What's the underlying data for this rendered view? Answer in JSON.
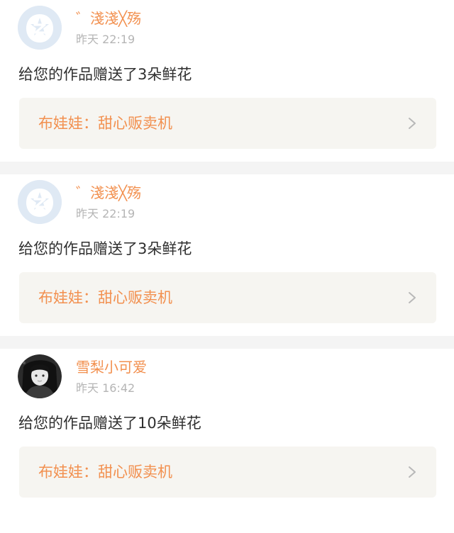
{
  "notifications": [
    {
      "avatar_icon": "qq-default-avatar-icon",
      "username": "゛淺淺╳殇",
      "time": "昨天 22:19",
      "message": "给您的作品赠送了3朵鲜花",
      "work_link": "布娃娃：甜心贩卖机"
    },
    {
      "avatar_icon": "qq-default-avatar-icon",
      "username": "゛淺淺╳殇",
      "time": "昨天 22:19",
      "message": "给您的作品赠送了3朵鲜花",
      "work_link": "布娃娃：甜心贩卖机"
    },
    {
      "avatar_icon": "user-photo-avatar",
      "username": "雪梨小可爱",
      "time": "昨天 16:42",
      "message": "给您的作品赠送了10朵鲜花",
      "work_link": "布娃娃：甜心贩卖机"
    }
  ],
  "colors": {
    "accent": "#f2904f",
    "time": "#b5b5b5",
    "text": "#2f2f2f",
    "link_bg": "#f6f5f1",
    "divider": "#f4f4f4"
  }
}
